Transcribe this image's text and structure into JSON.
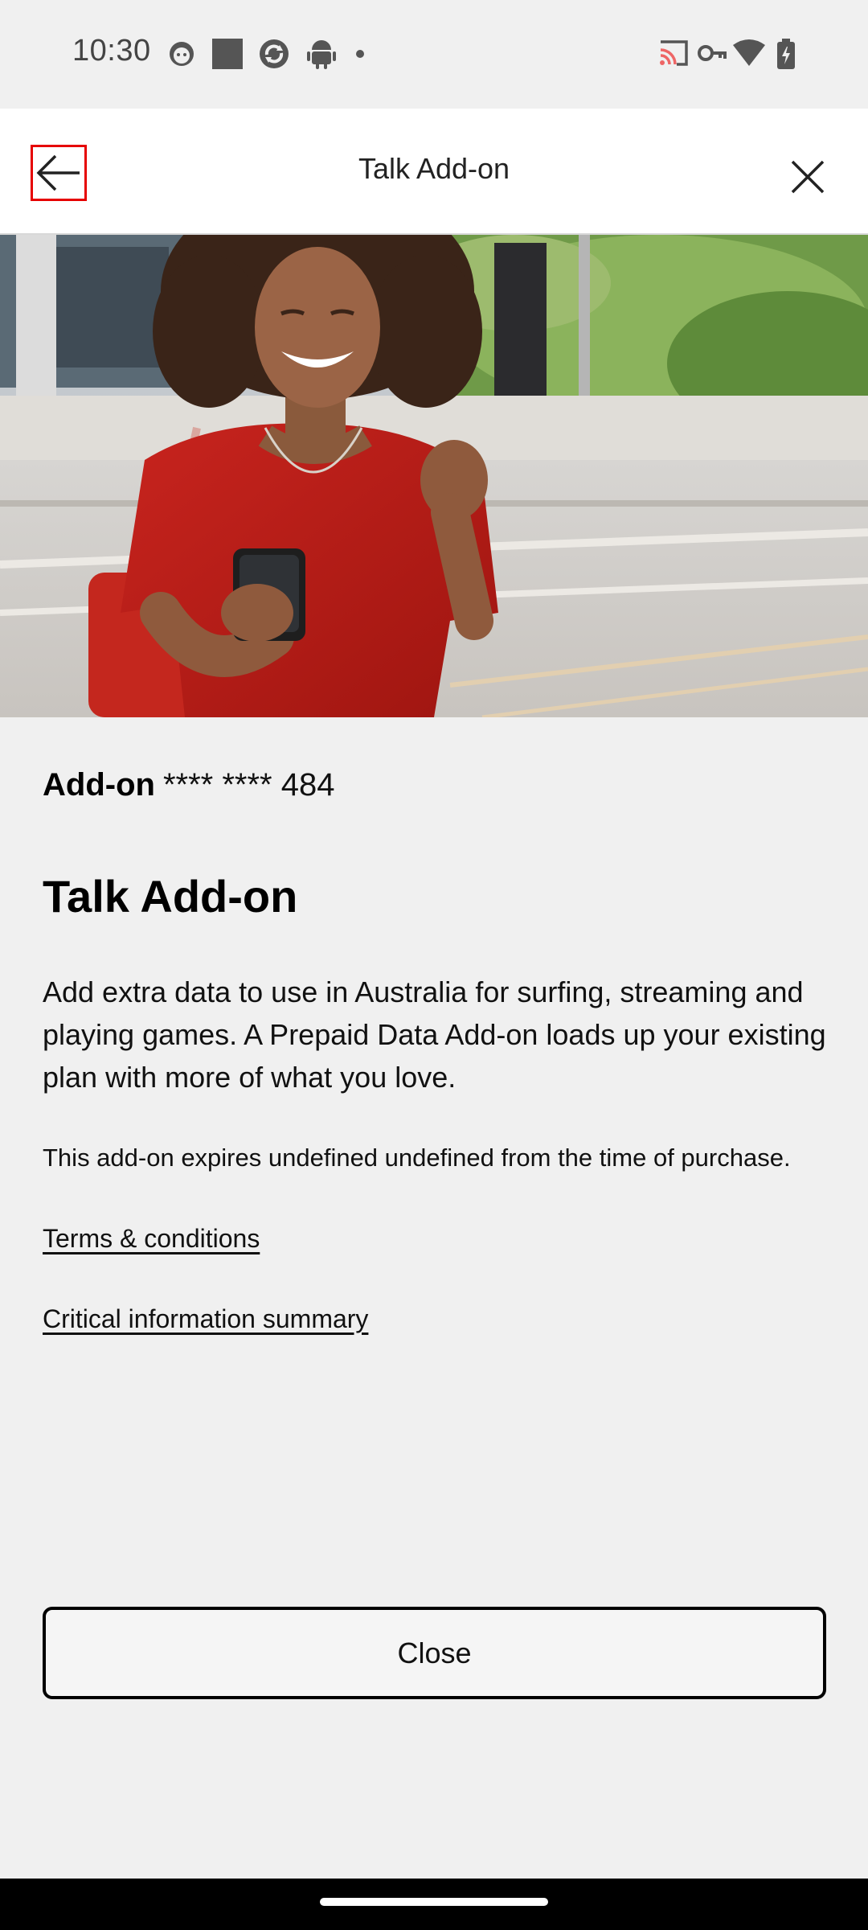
{
  "status_bar": {
    "time": "10:30",
    "left_icons": [
      "cat-face-icon",
      "square-icon",
      "sync-icon",
      "android-icon",
      "dot-icon"
    ],
    "right_icons": [
      "cast-icon",
      "vpn-key-icon",
      "wifi-icon",
      "battery-icon"
    ]
  },
  "header": {
    "title": "Talk Add-on",
    "back_icon": "arrow-left-icon",
    "close_icon": "close-icon"
  },
  "hero": {
    "image": "woman-with-phone-photo"
  },
  "content": {
    "addon_label": "Add-on",
    "addon_number": "**** **** 484",
    "title": "Talk Add-on",
    "description": "Add extra data to use in Australia for surfing, streaming and playing games. A Prepaid Data Add-on loads up your existing plan with more of what you love.",
    "expiry": "This add-on expires undefined undefined from the time of purchase.",
    "terms_link": "Terms & conditions",
    "cis_link": "Critical information summary"
  },
  "footer": {
    "close_label": "Close"
  },
  "colors": {
    "accent_red": "#e60000",
    "background": "#f0f0f0",
    "header_bg": "#ffffff"
  }
}
